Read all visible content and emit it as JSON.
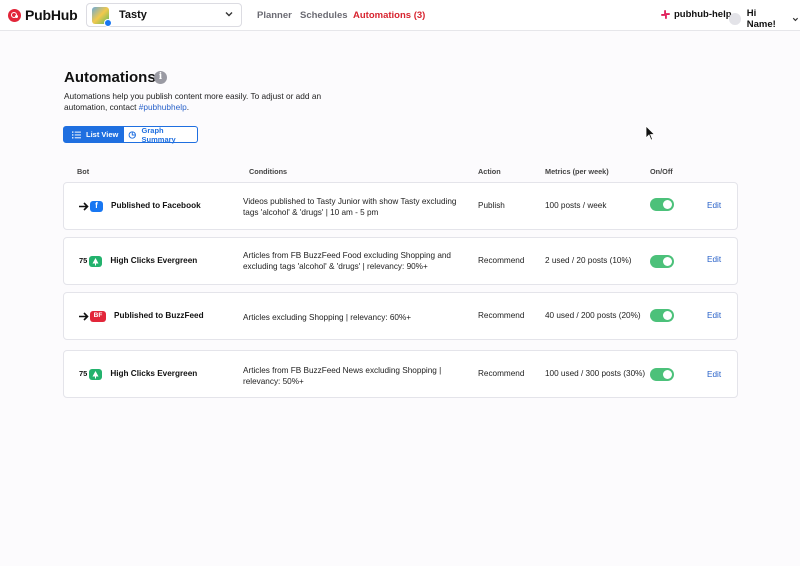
{
  "app": {
    "name": "PubHub"
  },
  "page_selector": {
    "label": "Tasty"
  },
  "nav": {
    "planner": "Planner",
    "schedules": "Schedules",
    "automations": "Automations (3)"
  },
  "help": {
    "label": "pubhub-help"
  },
  "user": {
    "greeting": "Hi Name!"
  },
  "header": {
    "title": "Automations",
    "info": "i",
    "desc_text": "Automations help you publish content more easily. To adjust or add an automation, contact ",
    "desc_link": "#pubhubhelp",
    "desc_end": "."
  },
  "view_toggle": {
    "list": "List View",
    "graph": "Graph Summary"
  },
  "columns": {
    "bot": "Bot",
    "conditions": "Conditions",
    "action": "Action",
    "metrics": "Metrics (per week)",
    "onoff": "On/Off"
  },
  "rows": [
    {
      "bot": "Published to Facebook",
      "conditions": "Videos published to Tasty Junior with show Tasty excluding tags 'alcohol' & 'drugs' | 10 am - 5 pm",
      "action": "Publish",
      "metrics": "100 posts / week",
      "on": true,
      "edit": "Edit"
    },
    {
      "score": "75",
      "bot": "High Clicks Evergreen",
      "conditions": "Articles from FB BuzzFeed Food excluding Shopping and excluding tags 'alcohol' & 'drugs' | relevancy: 90%+",
      "action": "Recommend",
      "metrics": "2 used / 20 posts (10%)",
      "on": true,
      "edit": "Edit"
    },
    {
      "badge": "BF",
      "bot": "Published to BuzzFeed",
      "conditions": "Articles excluding Shopping | relevancy: 60%+",
      "action": "Recommend",
      "metrics": "40 used / 200 posts (20%)",
      "on": true,
      "edit": "Edit"
    },
    {
      "score": "75",
      "bot": "High Clicks Evergreen",
      "conditions": "Articles from FB BuzzFeed News excluding Shopping | relevancy: 50%+",
      "action": "Recommend",
      "metrics": "100 used / 300 posts (30%)",
      "on": true,
      "edit": "Edit"
    }
  ],
  "colors": {
    "brand_red": "#e2263a",
    "primary_blue": "#1f6fe0",
    "toggle_green": "#4cc17a",
    "evergreen": "#23b26d",
    "facebook": "#1877f2"
  }
}
